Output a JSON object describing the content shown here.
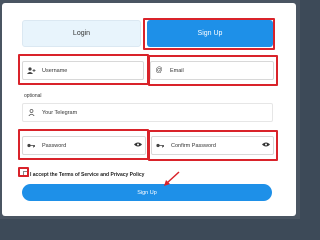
{
  "tabs": {
    "login_label": "Login",
    "signup_label": "Sign Up"
  },
  "fields": {
    "username_placeholder": "Username",
    "email_placeholder": "Email",
    "optional_label": "optional",
    "telegram_placeholder": "Your Telegram",
    "password_placeholder": "Password",
    "confirm_password_placeholder": "Confirm Password"
  },
  "terms_label": "I accept the Terms of Service and Privacy Policy",
  "submit_label": "Sign Up",
  "colors": {
    "accent": "#1e90e8",
    "highlight": "#d9232a",
    "login_tab_bg": "#e8f4fc"
  },
  "icons": {
    "username": "user-plus-icon",
    "email": "at-icon",
    "telegram": "user-icon",
    "password": "key-icon",
    "confirm_password": "key-icon",
    "visibility": "eye-icon"
  }
}
